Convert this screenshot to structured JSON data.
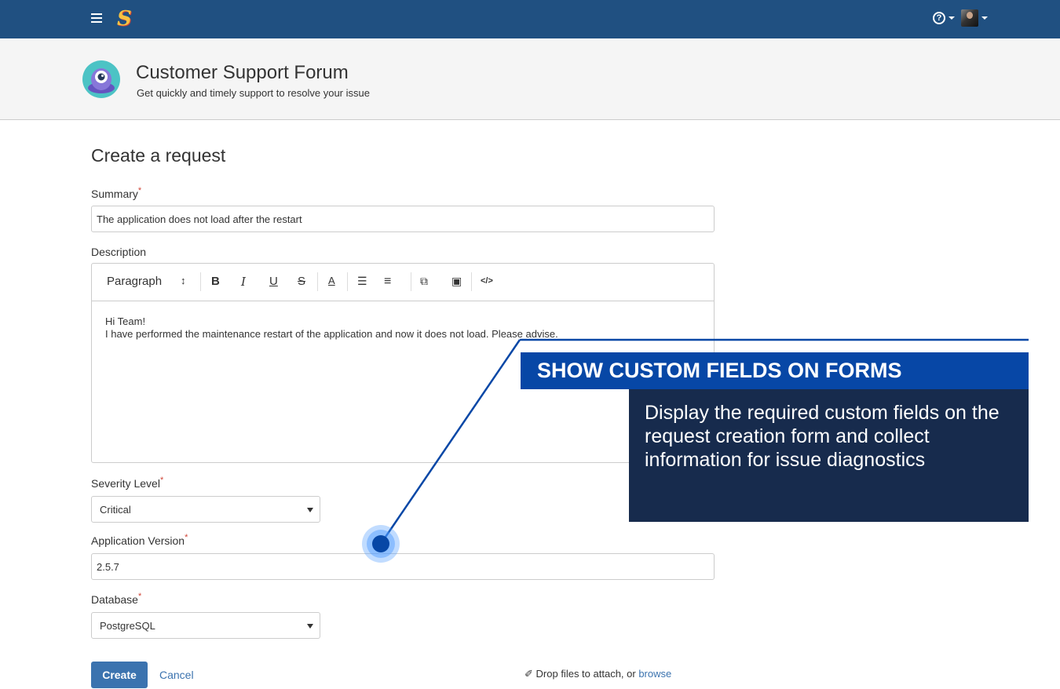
{
  "topbar": {
    "logo_letter": "S",
    "help_glyph": "?",
    "icons": {
      "menu": "hamburger-menu-icon",
      "help": "question-circle-icon",
      "avatar": "user-avatar-icon"
    }
  },
  "portal": {
    "title": "Customer Support Forum",
    "subtitle": "Get quickly and timely support to resolve your issue"
  },
  "form": {
    "title": "Create a request",
    "summary": {
      "label": "Summary",
      "required": "*",
      "value": "The application does not load after the restart"
    },
    "description": {
      "label": "Description",
      "toolbar": {
        "paragraph": "Paragraph",
        "paragraph_caret": "↕",
        "bold": "B",
        "italic": "I",
        "underline": "U",
        "strike": "S",
        "color": "A",
        "ordered": "☰",
        "bullets": "≡",
        "link": "⧉",
        "image": "▣",
        "code": "</>"
      },
      "line1": "Hi Team!",
      "line2": "I have performed the maintenance restart of the application and now it does not load. Please advise."
    },
    "severity": {
      "label": "Severity Level",
      "required": "*",
      "value": "Critical"
    },
    "version": {
      "label": "Application Version",
      "required": "*",
      "value": "2.5.7"
    },
    "database": {
      "label": "Database",
      "required": "*",
      "value": "PostgreSQL"
    },
    "create_label": "Create",
    "cancel_label": "Cancel",
    "drop_text": "Drop files to attach, or ",
    "browse_label": "browse",
    "paperclip": "✐"
  },
  "callout": {
    "title": "SHOW CUSTOM FIELDS ON FORMS",
    "body": "Display the required custom fields on the request creation form and collect information for issue diagnostics"
  },
  "colors": {
    "topbar": "#205081",
    "header_bg": "#f5f5f5",
    "primary": "#3b73af",
    "required": "#d04437",
    "callout_title_bg": "#0747a6",
    "callout_body_bg": "#172b4d"
  }
}
